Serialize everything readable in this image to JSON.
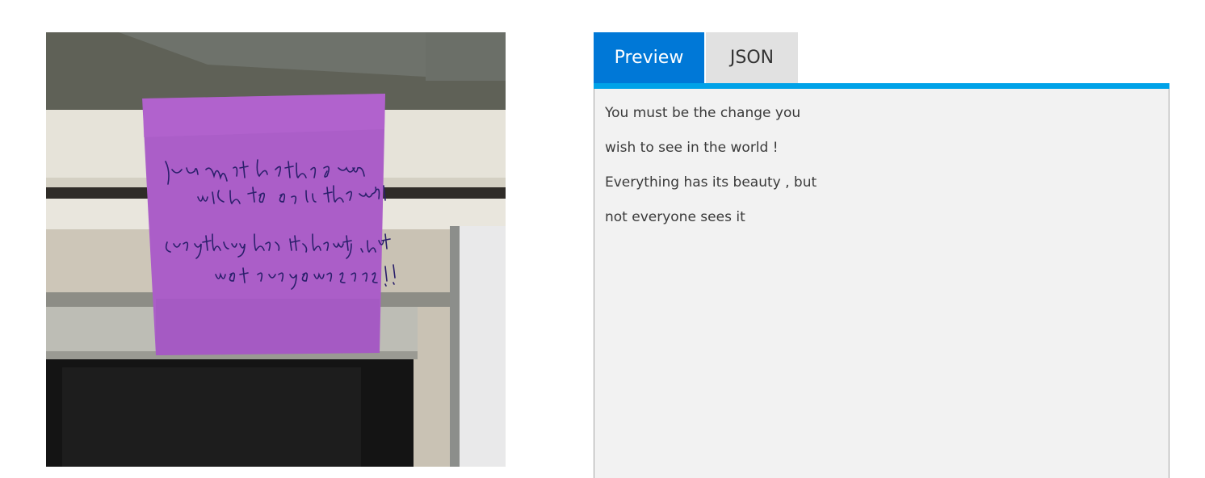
{
  "image": {
    "description_icon": "photo-image",
    "note_text": [
      "You must be the change you",
      "wish to see in the world !",
      "Everything has its beauty , but",
      "not everyone sees it !"
    ]
  },
  "tabs": [
    {
      "label": "Preview",
      "active": true
    },
    {
      "label": "JSON",
      "active": false
    }
  ],
  "output": {
    "lines": [
      "You must be the change you",
      "wish to see in the world !",
      "Everything has its beauty , but",
      "not everyone sees it"
    ]
  },
  "colors": {
    "accent": "#0078d7",
    "underline": "#00a2e8",
    "note": "#a855c8"
  }
}
